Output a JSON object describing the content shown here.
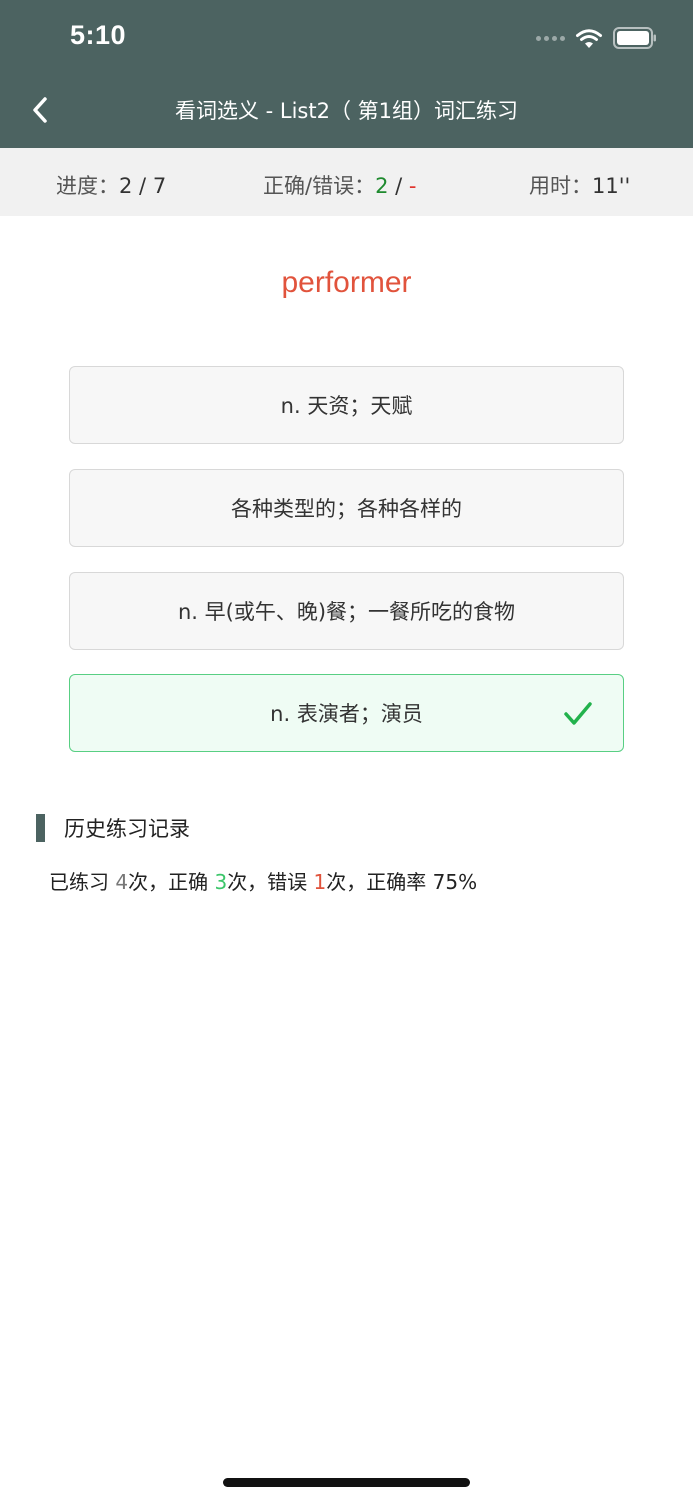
{
  "status_bar": {
    "time": "5:10"
  },
  "nav": {
    "title": "看词选义 - List2（ 第1组）词汇练习",
    "back_icon": "chevron-left-icon"
  },
  "stats": {
    "progress_label": "进度：",
    "progress_current": "2",
    "progress_sep": " / ",
    "progress_total": "7",
    "correct_label": "正确/错误：",
    "correct_count": "2",
    "correct_sep": " / ",
    "wrong_count": "-",
    "time_label": "用时：",
    "time_value": "11''"
  },
  "word": "performer",
  "options": [
    {
      "text": "n. 天资；天赋",
      "state": "normal"
    },
    {
      "text": "各种类型的；各种各样的",
      "state": "normal"
    },
    {
      "text": "n. 早(或午、晚)餐；一餐所吃的食物",
      "state": "normal"
    },
    {
      "text": "n. 表演者；演员",
      "state": "correct"
    }
  ],
  "history": {
    "title": "历史练习记录",
    "practiced_prefix": "已练习 ",
    "practiced_count": "4",
    "practiced_suffix": "次，正确 ",
    "correct_count": "3",
    "correct_suffix": "次，错误 ",
    "wrong_count": "1",
    "wrong_suffix": "次，正确率 ",
    "rate": "75%"
  },
  "colors": {
    "header_bg": "#4c6361",
    "word": "#e1533c",
    "correct_border": "#58cf83",
    "correct_bg": "#effcf4",
    "check": "#22b24c"
  }
}
